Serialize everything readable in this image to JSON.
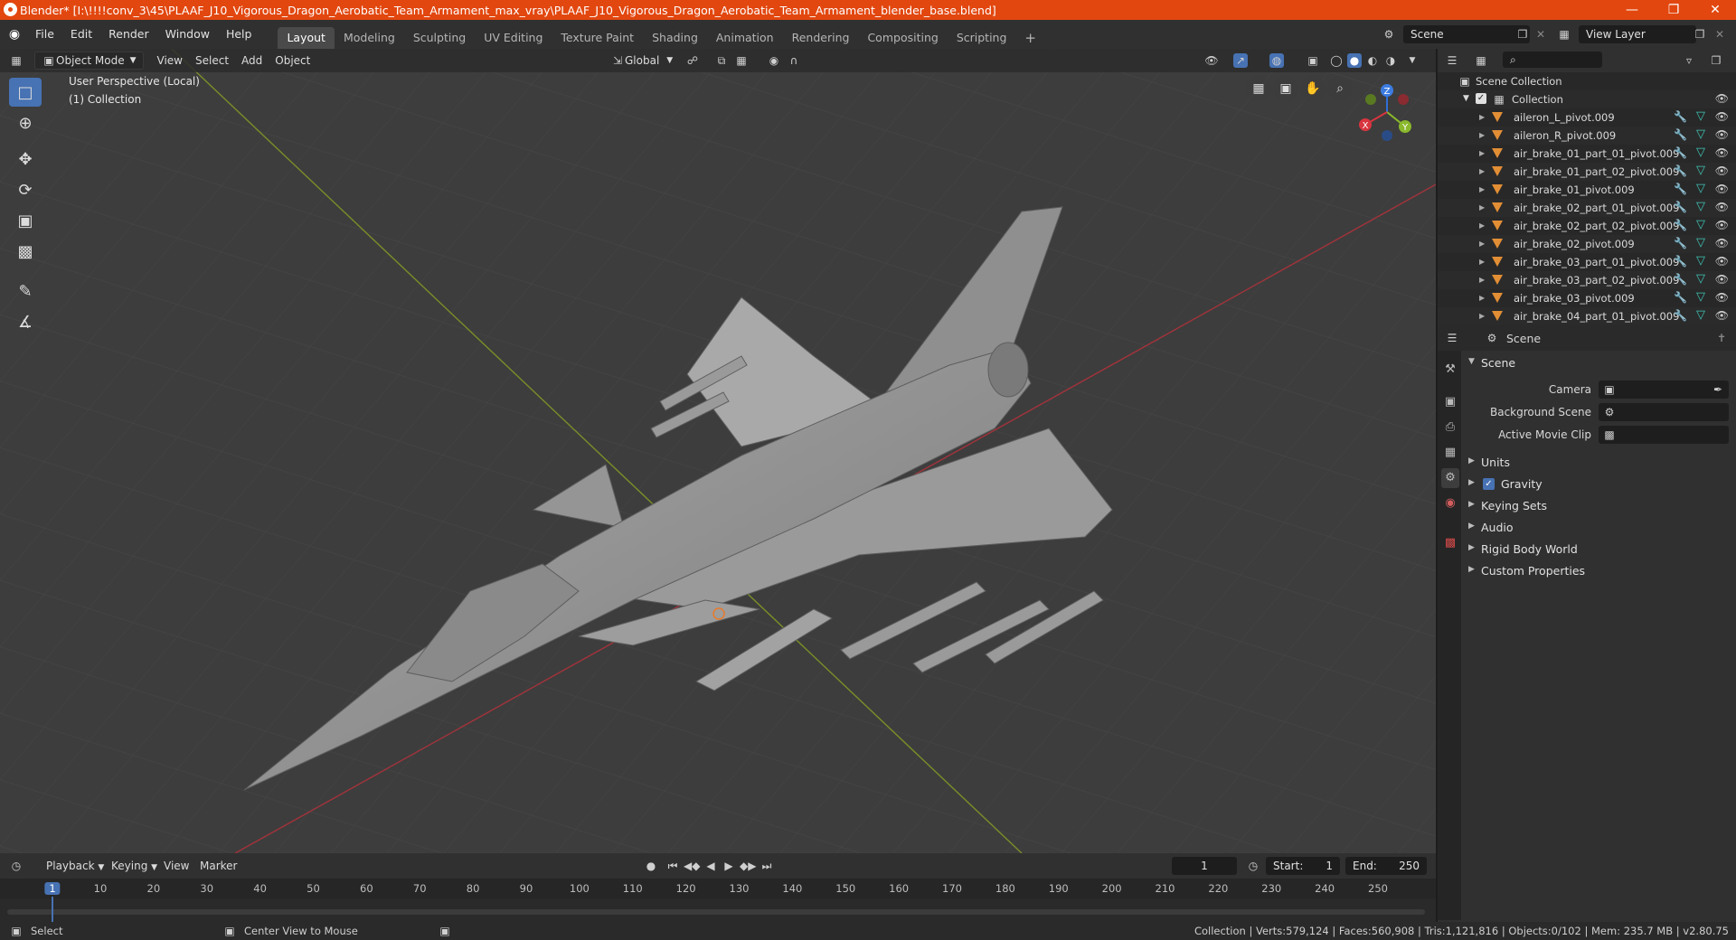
{
  "window": {
    "title": "Blender* [I:\\!!!!conv_3\\45\\PLAAF_J10_Vigorous_Dragon_Aerobatic_Team_Armament_max_vray\\PLAAF_J10_Vigorous_Dragon_Aerobatic_Team_Armament_blender_base.blend]",
    "accent": "#e2470f"
  },
  "menu": [
    "File",
    "Edit",
    "Render",
    "Window",
    "Help"
  ],
  "workspaces": [
    "Layout",
    "Modeling",
    "Sculpting",
    "UV Editing",
    "Texture Paint",
    "Shading",
    "Animation",
    "Rendering",
    "Compositing",
    "Scripting"
  ],
  "active_workspace": "Layout",
  "scene_field": "Scene",
  "view_layer_field": "View Layer",
  "viewport": {
    "mode": "Object Mode",
    "menus": [
      "View",
      "Select",
      "Add",
      "Object"
    ],
    "transform_orientation": "Global",
    "info_line1": "User Perspective (Local)",
    "info_line2": "(1) Collection",
    "gizmo": {
      "x": "X",
      "y": "Y",
      "z": "Z"
    }
  },
  "outliner": {
    "search_placeholder": "",
    "scene_collection": "Scene Collection",
    "collection": "Collection",
    "items": [
      {
        "name": "aileron_L_pivot.009",
        "wrench": true
      },
      {
        "name": "aileron_R_pivot.009",
        "wrench": true
      },
      {
        "name": "air_brake_01_part_01_pivot.009",
        "wrench": true
      },
      {
        "name": "air_brake_01_part_02_pivot.009",
        "wrench": true
      },
      {
        "name": "air_brake_01_pivot.009",
        "wrench": true
      },
      {
        "name": "air_brake_02_part_01_pivot.009",
        "wrench": true
      },
      {
        "name": "air_brake_02_part_02_pivot.009",
        "wrench": true
      },
      {
        "name": "air_brake_02_pivot.009",
        "wrench": true
      },
      {
        "name": "air_brake_03_part_01_pivot.009",
        "wrench": true
      },
      {
        "name": "air_brake_03_part_02_pivot.009",
        "wrench": true
      },
      {
        "name": "air_brake_03_pivot.009",
        "wrench": true
      },
      {
        "name": "air_brake_04_part_01_pivot.009",
        "wrench": true
      }
    ]
  },
  "properties": {
    "header": "Scene",
    "panel_title": "Scene",
    "camera_label": "Camera",
    "background_scene_label": "Background Scene",
    "active_movie_clip_label": "Active Movie Clip",
    "sections": [
      "Units",
      "Gravity",
      "Keying Sets",
      "Audio",
      "Rigid Body World",
      "Custom Properties"
    ],
    "gravity_checked": true
  },
  "timeline": {
    "menus": [
      "Playback",
      "Keying",
      "View",
      "Marker"
    ],
    "current_frame": "1",
    "start_label": "Start:",
    "start_value": "1",
    "end_label": "End:",
    "end_value": "250",
    "ticks": [
      "1",
      "10",
      "20",
      "30",
      "40",
      "50",
      "60",
      "70",
      "80",
      "90",
      "100",
      "110",
      "120",
      "130",
      "140",
      "150",
      "160",
      "170",
      "180",
      "190",
      "200",
      "210",
      "220",
      "230",
      "240",
      "250"
    ]
  },
  "status": {
    "select": "Select",
    "center_view": "Center View to Mouse",
    "stats": "Collection | Verts:579,124 | Faces:560,908 | Tris:1,121,816 | Objects:0/102 | Mem: 235.7 MB | v2.80.75"
  }
}
